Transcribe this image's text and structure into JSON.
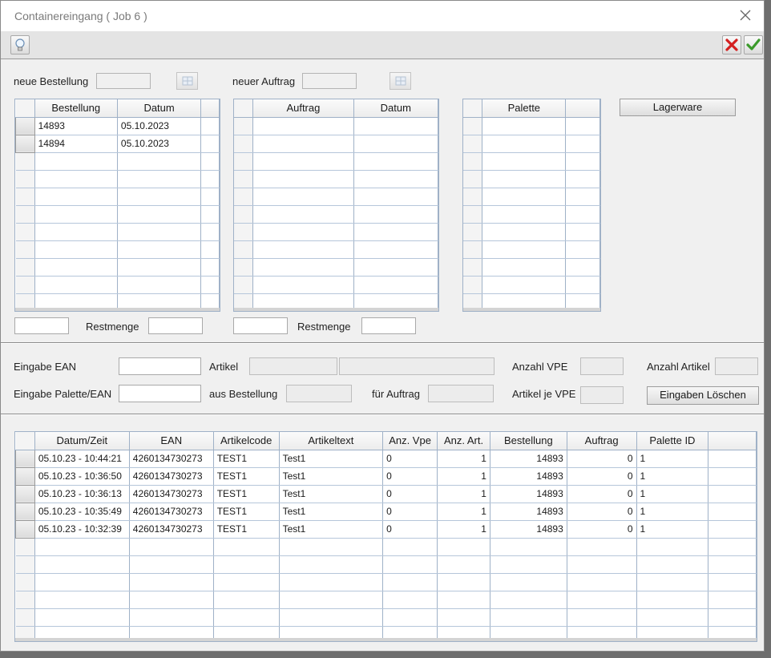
{
  "window": {
    "title": "Containereingang ( Job 6 )"
  },
  "toolbar": {
    "hint_icon": "lightbulb-icon",
    "cancel_icon": "red-x-icon",
    "ok_icon": "green-check-icon"
  },
  "top": {
    "neue_bestellung_label": "neue Bestellung",
    "neuer_auftrag_label": "neuer Auftrag",
    "lagerware_label": "Lagerware",
    "restmenge_label": "Restmenge"
  },
  "bestellung_grid": {
    "headers": [
      "Bestellung",
      "Datum"
    ],
    "rows": [
      [
        "14893",
        "05.10.2023"
      ],
      [
        "14894",
        "05.10.2023"
      ]
    ]
  },
  "auftrag_grid": {
    "headers": [
      "Auftrag",
      "Datum"
    ]
  },
  "palette_grid": {
    "headers": [
      "Palette"
    ]
  },
  "input": {
    "eingabe_ean_label": "Eingabe EAN",
    "artikel_label": "Artikel",
    "anzahl_vpe_label": "Anzahl VPE",
    "anzahl_artikel_label": "Anzahl Artikel",
    "eingabe_palette_label": "Eingabe Palette/EAN",
    "aus_bestellung_label": "aus Bestellung",
    "fuer_auftrag_label": "für Auftrag",
    "artikel_je_vpe_label": "Artikel je VPE",
    "clear_button_label": "Eingaben Löschen"
  },
  "log_grid": {
    "headers": [
      "Datum/Zeit",
      "EAN",
      "Artikelcode",
      "Artikeltext",
      "Anz. Vpe",
      "Anz. Art.",
      "Bestellung",
      "Auftrag",
      "Palette ID"
    ],
    "rows": [
      [
        "05.10.23 - 10:44:21",
        "4260134730273",
        "TEST1",
        "Test1",
        "0",
        "1",
        "14893",
        "0",
        "1"
      ],
      [
        "05.10.23 - 10:36:50",
        "4260134730273",
        "TEST1",
        "Test1",
        "0",
        "1",
        "14893",
        "0",
        "1"
      ],
      [
        "05.10.23 - 10:36:13",
        "4260134730273",
        "TEST1",
        "Test1",
        "0",
        "1",
        "14893",
        "0",
        "1"
      ],
      [
        "05.10.23 - 10:35:49",
        "4260134730273",
        "TEST1",
        "Test1",
        "0",
        "1",
        "14893",
        "0",
        "1"
      ],
      [
        "05.10.23 - 10:32:39",
        "4260134730273",
        "TEST1",
        "Test1",
        "0",
        "1",
        "14893",
        "0",
        "1"
      ]
    ]
  }
}
